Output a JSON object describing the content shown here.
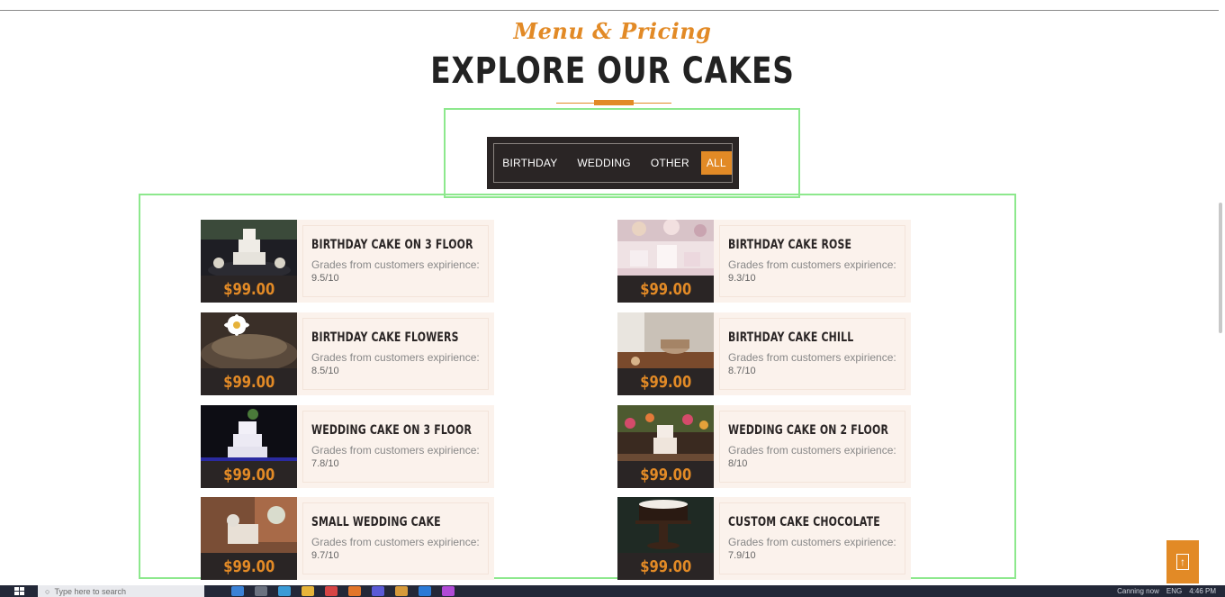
{
  "section": {
    "subtitle": "Menu & Pricing",
    "title": "EXPLORE OUR CAKES"
  },
  "filters": [
    {
      "label": "BIRTHDAY",
      "active": false
    },
    {
      "label": "WEDDING",
      "active": false
    },
    {
      "label": "OTHER",
      "active": false
    },
    {
      "label": "ALL",
      "active": true
    }
  ],
  "cakes": [
    {
      "name": "BIRTHDAY CAKE ON 3 FLOOR",
      "price": "$99.00",
      "desc": "Grades from customers expirience:",
      "grade": "9.5/10"
    },
    {
      "name": "BIRTHDAY CAKE ROSE",
      "price": "$99.00",
      "desc": "Grades from customers expirience:",
      "grade": "9.3/10"
    },
    {
      "name": "BIRTHDAY CAKE FLOWERS",
      "price": "$99.00",
      "desc": "Grades from customers expirience:",
      "grade": "8.5/10"
    },
    {
      "name": "BIRTHDAY CAKE CHILL",
      "price": "$99.00",
      "desc": "Grades from customers expirience:",
      "grade": "8.7/10"
    },
    {
      "name": "WEDDING CAKE ON 3 FLOOR",
      "price": "$99.00",
      "desc": "Grades from customers expirience:",
      "grade": "7.8/10"
    },
    {
      "name": "WEDDING CAKE ON 2 FLOOR",
      "price": "$99.00",
      "desc": "Grades from customers expirience:",
      "grade": "8/10"
    },
    {
      "name": "SMALL WEDDING CAKE",
      "price": "$99.00",
      "desc": "Grades from customers expirience:",
      "grade": "9.7/10"
    },
    {
      "name": "CUSTOM CAKE CHOCOLATE",
      "price": "$99.00",
      "desc": "Grades from customers expirience:",
      "grade": "7.9/10"
    }
  ],
  "scroll_top": {
    "icon": "arrow-up-icon",
    "glyph": "↑"
  },
  "taskbar": {
    "search_placeholder": "Type here to search",
    "tray_label": "Canning now",
    "lang": "ENG",
    "time": "4:46 PM"
  },
  "colors": {
    "accent": "#e28a26",
    "dark": "#2a2525",
    "card_bg": "#fbf2ec",
    "highlight": "#8de88d"
  }
}
